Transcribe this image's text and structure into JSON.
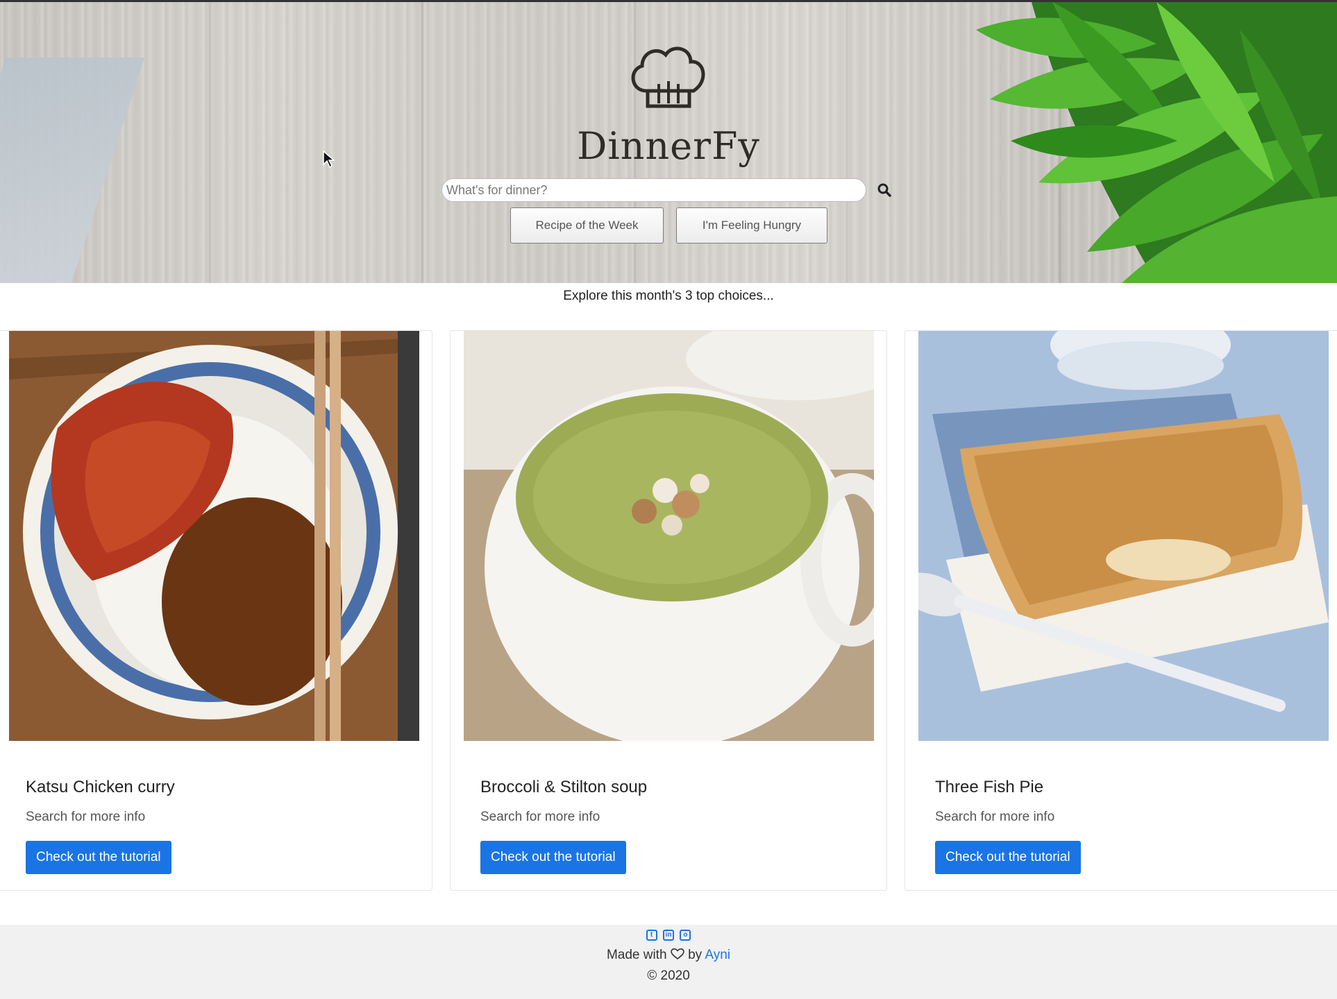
{
  "brand": {
    "name": "DinnerFy"
  },
  "search": {
    "placeholder": "What's for dinner?"
  },
  "hero_buttons": {
    "recipe_of_week": "Recipe of the Week",
    "feeling_hungry": "I'm Feeling Hungry"
  },
  "tagline": "Explore this month's 3 top choices...",
  "cards": [
    {
      "title": "Katsu Chicken curry",
      "text": "Search for more info",
      "button": "Check out the tutorial"
    },
    {
      "title": "Broccoli & Stilton soup",
      "text": "Search for more info",
      "button": "Check out the tutorial"
    },
    {
      "title": "Three Fish Pie",
      "text": "Search for more info",
      "button": "Check out the tutorial"
    }
  ],
  "footer": {
    "social_icons": [
      "twitter-icon",
      "linkedin-icon",
      "github-icon"
    ],
    "made_with": "Made with",
    "by": "by",
    "author": "Ayni",
    "copyright": "© 2020"
  },
  "colors": {
    "accent": "#1b74e4",
    "footer_bg": "#f1f1f1",
    "wood": "#d0cdc8",
    "leaf": "#3f9c2a"
  }
}
